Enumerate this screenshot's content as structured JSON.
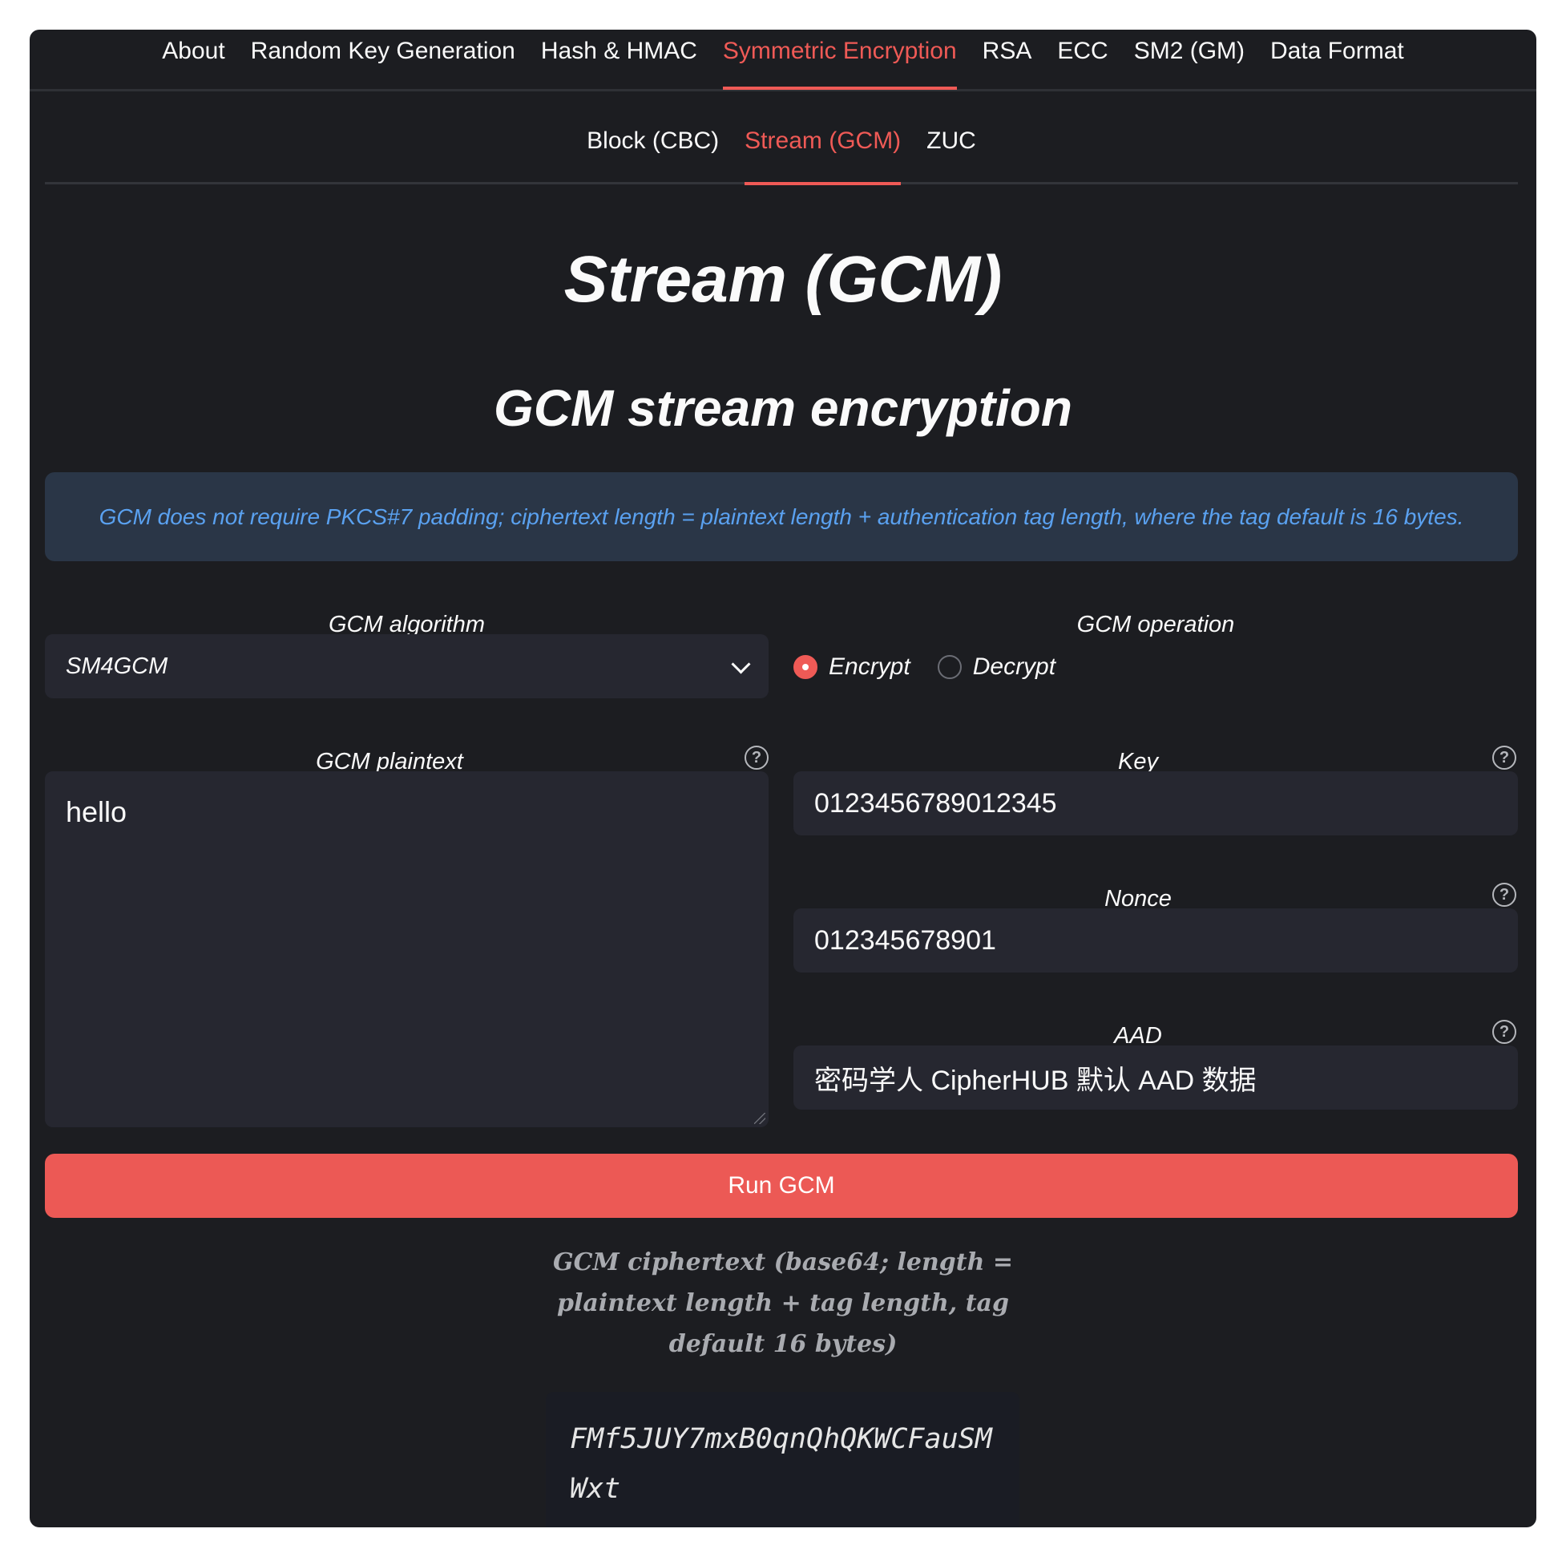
{
  "top_nav": {
    "tabs": [
      "About",
      "Random Key Generation",
      "Hash & HMAC",
      "Symmetric Encryption",
      "RSA",
      "ECC",
      "SM2 (GM)",
      "Data Format"
    ],
    "active": "Symmetric Encryption"
  },
  "sub_nav": {
    "tabs": [
      "Block (CBC)",
      "Stream (GCM)",
      "ZUC"
    ],
    "active": "Stream (GCM)"
  },
  "page": {
    "title": "Stream (GCM)",
    "subtitle": "GCM stream encryption",
    "info": "GCM does not require PKCS#7 padding; ciphertext length = plaintext length + authentication tag length, where the tag default is 16 bytes."
  },
  "algorithm": {
    "label": "GCM algorithm",
    "value": "SM4GCM"
  },
  "operation": {
    "label": "GCM operation",
    "options": [
      "Encrypt",
      "Decrypt"
    ],
    "selected": "Encrypt"
  },
  "plaintext": {
    "label": "GCM plaintext",
    "value": "hello"
  },
  "key": {
    "label": "Key",
    "value": "0123456789012345"
  },
  "nonce": {
    "label": "Nonce",
    "value": "012345678901"
  },
  "aad": {
    "label": "AAD",
    "value": "密码学人 CipherHUB 默认 AAD 数据"
  },
  "run_button": "Run GCM",
  "output": {
    "label": "GCM ciphertext (base64; length = plaintext length + tag length, tag default 16 bytes)",
    "value": "FMf5JUY7mxB0qnQhQKWCFauSMWxt"
  },
  "colors": {
    "accent": "#ef5a56",
    "background": "#1c1d21",
    "info_bg": "#2a3647",
    "info_text": "#5aa1f0"
  },
  "icons": {
    "help": "question-circle-icon",
    "dropdown": "chevron-down-icon"
  }
}
